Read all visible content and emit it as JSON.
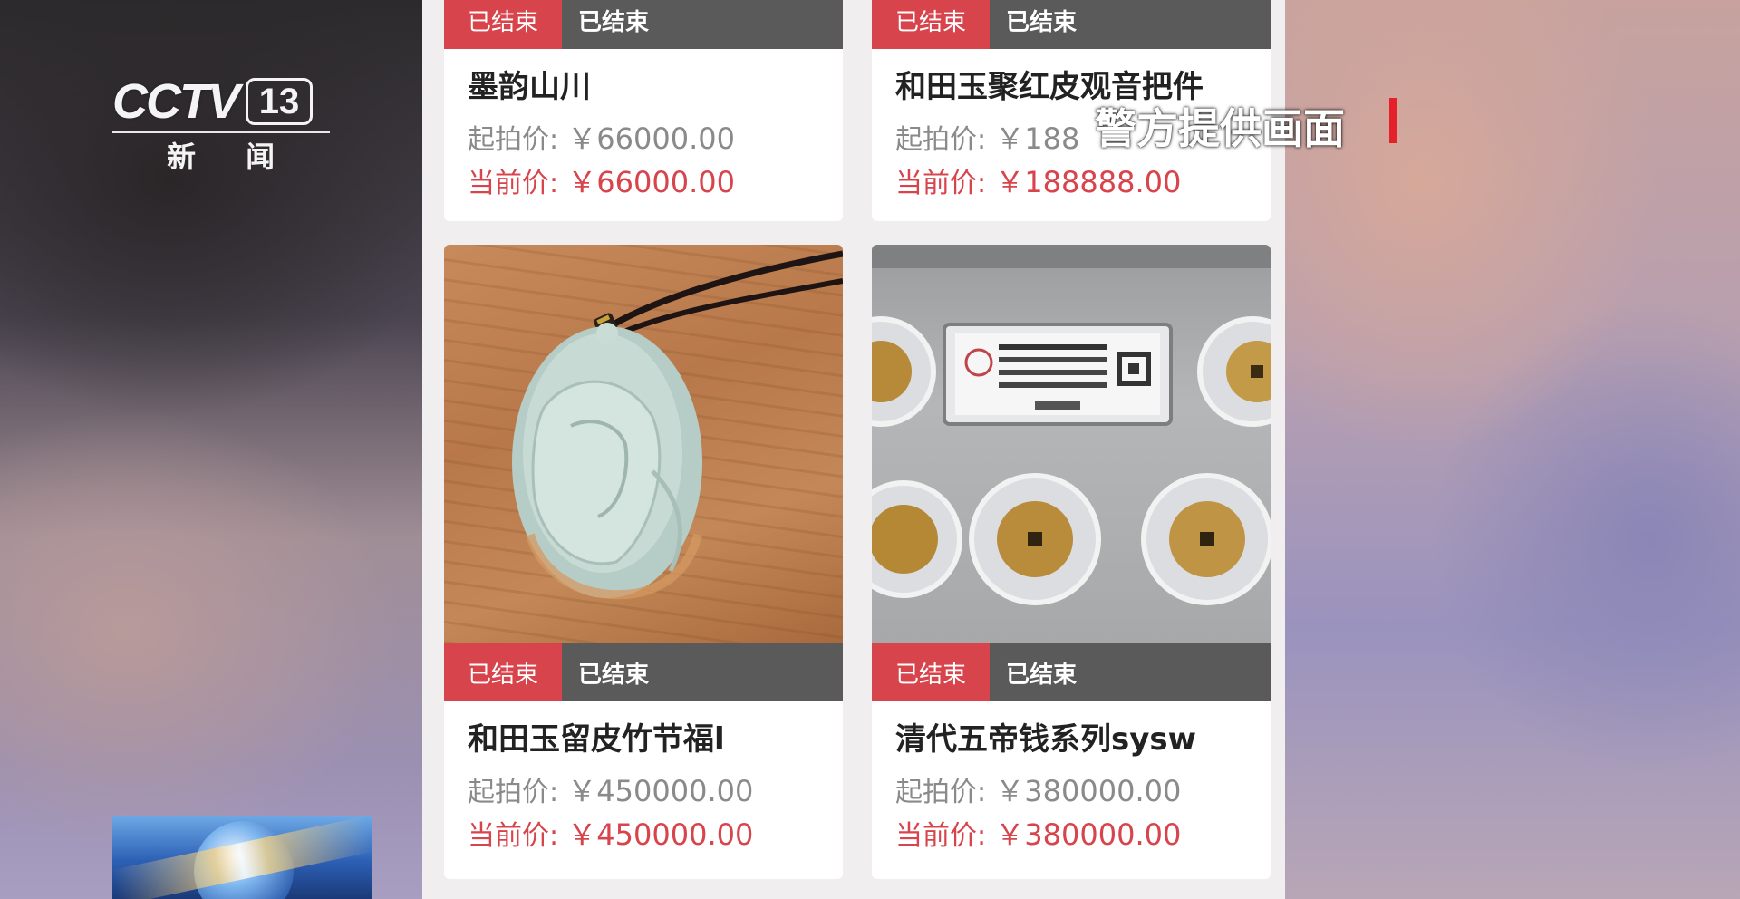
{
  "channel": {
    "logo_text": "CCTV",
    "channel_number": "13",
    "channel_name": "新 闻"
  },
  "watermark": "警方提供画面",
  "cards": [
    {
      "status_primary": "已结束",
      "status_secondary": "已结束",
      "title": "墨韵山川",
      "start_label": "起拍价:",
      "start_price": "￥66000.00",
      "current_label": "当前价:",
      "current_price": "￥66000.00"
    },
    {
      "status_primary": "已结束",
      "status_secondary": "已结束",
      "title": "和田玉聚红皮观音把件",
      "start_label": "起拍价:",
      "start_price": "￥188",
      "current_label": "当前价:",
      "current_price": "￥188888.00"
    },
    {
      "status_primary": "已结束",
      "status_secondary": "已结束",
      "title": "和田玉留皮竹节福l",
      "start_label": "起拍价:",
      "start_price": "￥450000.00",
      "current_label": "当前价:",
      "current_price": "￥450000.00"
    },
    {
      "status_primary": "已结束",
      "status_secondary": "已结束",
      "title": "清代五帝钱系列sysw",
      "start_label": "起拍价:",
      "start_price": "￥380000.00",
      "current_label": "当前价:",
      "current_price": "￥380000.00"
    }
  ],
  "colors": {
    "status_red": "#d8444c",
    "status_gray": "#5a5a5a",
    "price_red": "#d8444c"
  }
}
